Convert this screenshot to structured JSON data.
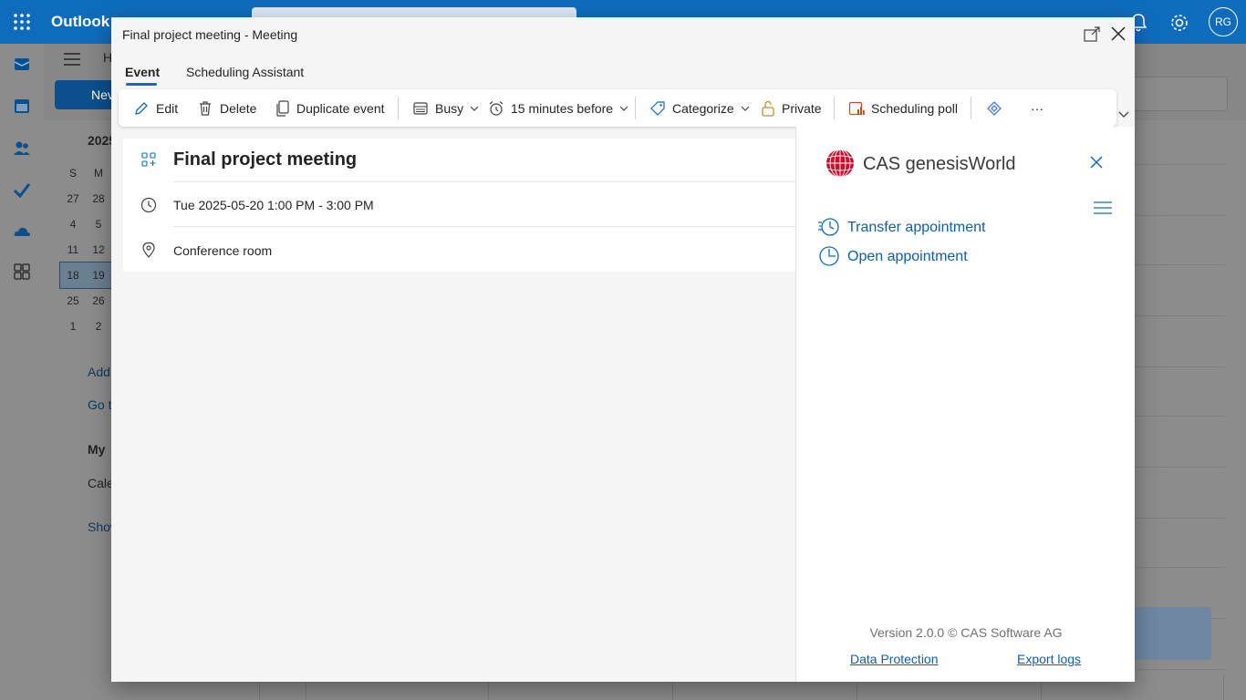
{
  "app": {
    "name": "Outlook",
    "avatar": "RG"
  },
  "background": {
    "home_tab": "H",
    "new_button": "Nev",
    "calendar_title": "2025",
    "mini_calendar": {
      "weekday_headers": [
        "S",
        "M"
      ],
      "rows": [
        [
          "27",
          "28"
        ],
        [
          "4",
          "5"
        ],
        [
          "11",
          "12"
        ],
        [
          "18",
          "19"
        ],
        [
          "25",
          "26"
        ],
        [
          "1",
          "2"
        ]
      ]
    },
    "side_links": [
      "Add",
      "Go t"
    ],
    "my_calendars": "My",
    "calendar_item": "Cale",
    "show_more": "Show"
  },
  "dialog": {
    "title": "Final project meeting - Meeting",
    "tabs": [
      {
        "label": "Event",
        "active": true
      },
      {
        "label": "Scheduling Assistant",
        "active": false
      }
    ],
    "toolbar": {
      "edit": "Edit",
      "delete": "Delete",
      "duplicate": "Duplicate event",
      "busy": "Busy",
      "reminder": "15 minutes before",
      "categorize": "Categorize",
      "private": "Private",
      "scheduling_poll": "Scheduling poll",
      "more": "···"
    },
    "event": {
      "title": "Final project meeting",
      "datetime": "Tue 2025-05-20 1:00 PM - 3:00 PM",
      "location": "Conference room"
    },
    "addin": {
      "name": "CAS genesisWorld",
      "transfer": "Transfer appointment",
      "open": "Open appointment",
      "version": "Version 2.0.0 © CAS Software AG",
      "data_protection": "Data Protection",
      "export_logs": "Export logs"
    }
  },
  "colors": {
    "brand": "#0f6cbd",
    "link": "#0f5ea8",
    "cas_red": "#c8102e"
  },
  "icons": [
    "waffle-icon",
    "gear-icon",
    "bell-icon",
    "mail-icon",
    "calendar-icon",
    "people-icon",
    "todo-icon",
    "onedrive-icon",
    "apps-icon",
    "popout-icon",
    "close-icon",
    "edit-icon",
    "delete-icon",
    "duplicate-icon",
    "busy-icon",
    "alarm-icon",
    "tag-icon",
    "lock-icon",
    "poll-icon",
    "teams-link-icon",
    "event-type-icon",
    "clock-icon",
    "location-icon",
    "cas-logo-icon",
    "menu-icon",
    "transfer-icon",
    "open-icon"
  ]
}
